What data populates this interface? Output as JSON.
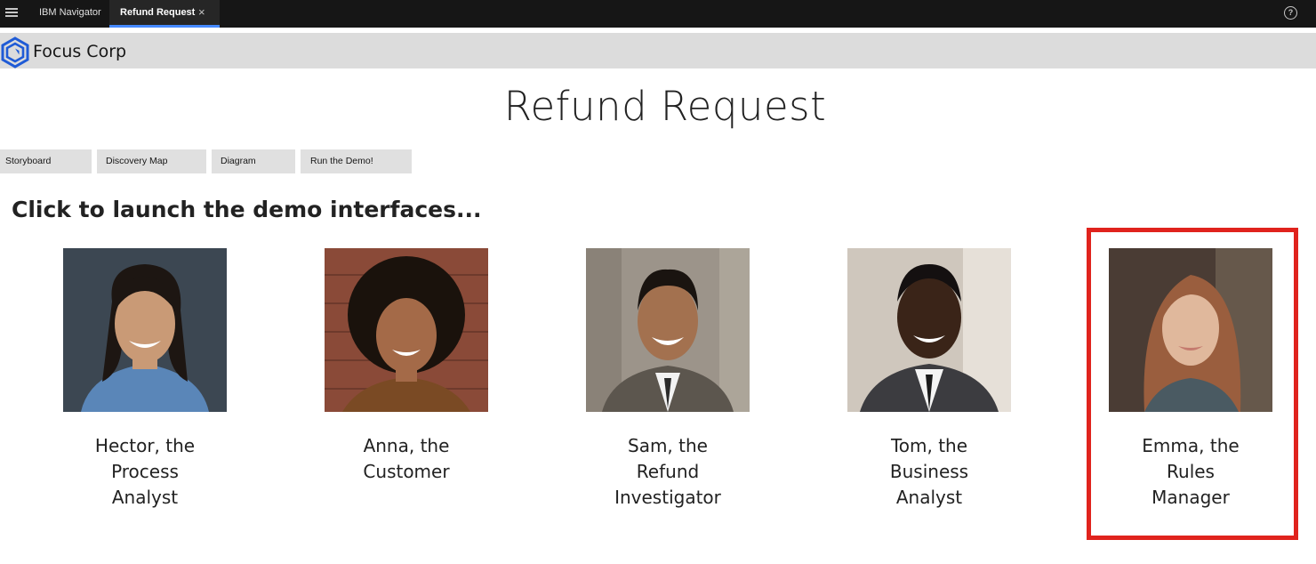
{
  "topbar": {
    "app_name": "IBM Navigator",
    "tab_label": "Refund Request",
    "tab_close": "×",
    "help_glyph": "?"
  },
  "brand": {
    "name": "Focus Corp"
  },
  "page": {
    "title": "Refund Request"
  },
  "nav": {
    "storyboard": "Storyboard",
    "discovery_map": "Discovery Map",
    "diagram": "Diagram",
    "run_demo": "Run the Demo!"
  },
  "section": {
    "heading": "Click to launch the demo interfaces..."
  },
  "personas": [
    {
      "line1": "Hector, the",
      "line2": "Process",
      "line3": "Analyst"
    },
    {
      "line1": "Anna, the",
      "line2": "Customer",
      "line3": ""
    },
    {
      "line1": "Sam, the",
      "line2": "Refund",
      "line3": "Investigator"
    },
    {
      "line1": "Tom, the",
      "line2": "Business",
      "line3": "Analyst"
    },
    {
      "line1": "Emma, the",
      "line2": "Rules",
      "line3": "Manager"
    }
  ],
  "colors": {
    "highlight": "#e0231d",
    "tab_accent": "#4589ff",
    "logo": "#1f5bd6"
  }
}
